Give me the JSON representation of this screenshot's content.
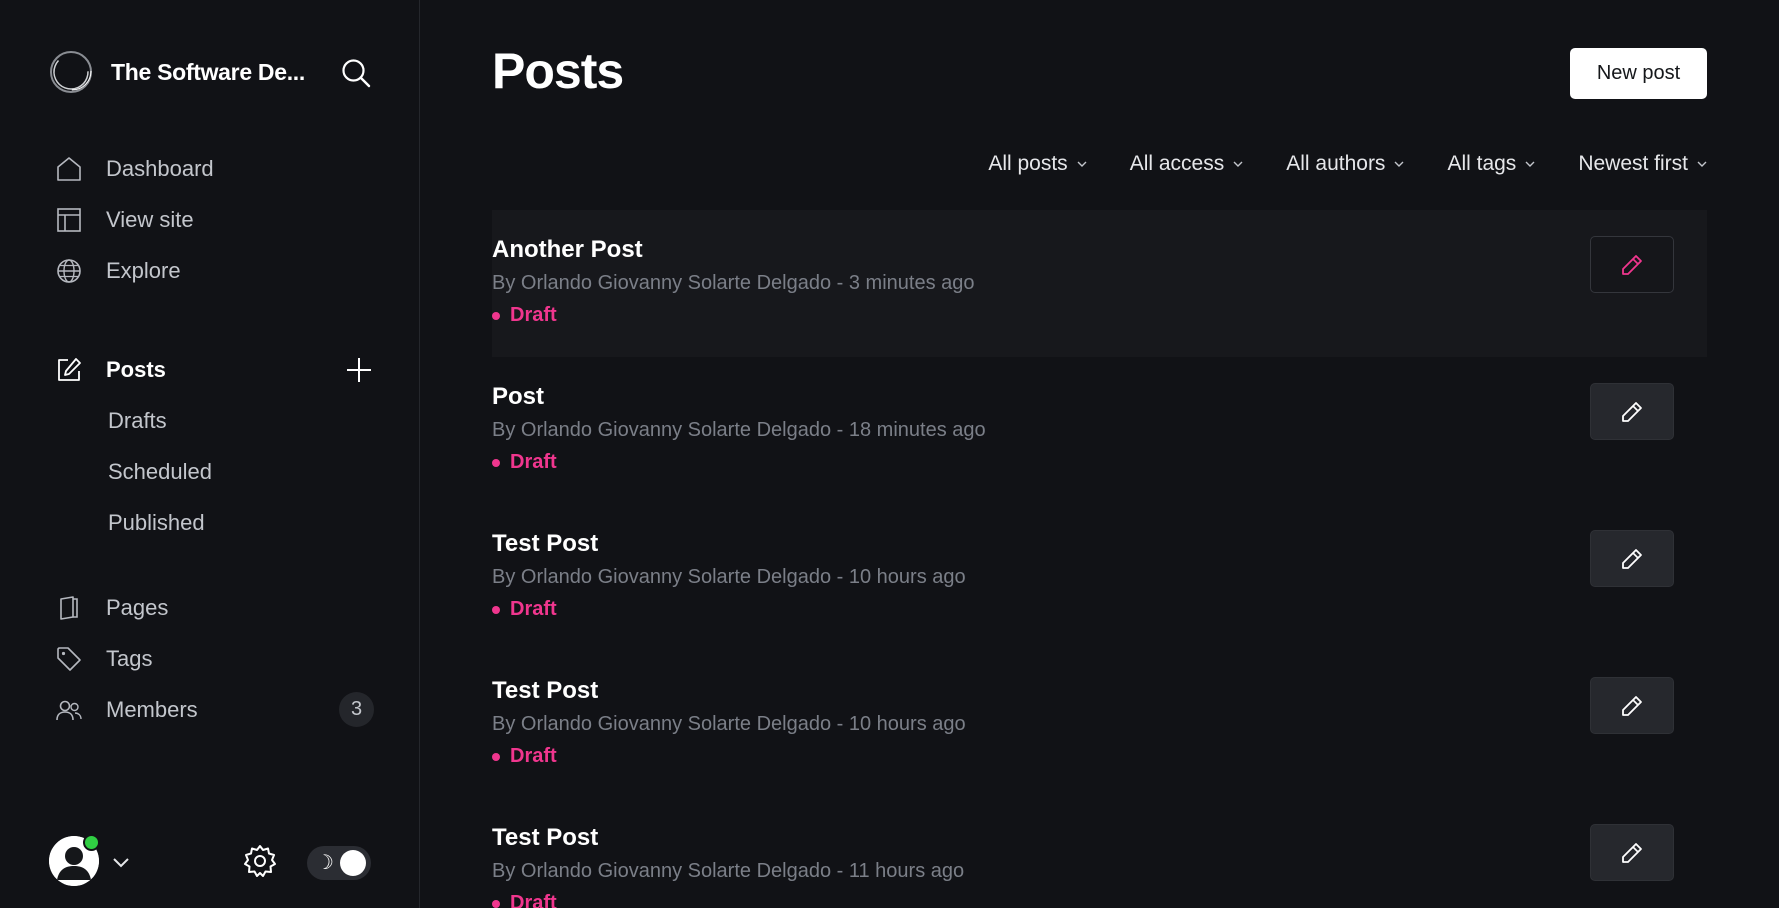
{
  "sidebar": {
    "brand_name": "The Software De...",
    "nav_top": [
      {
        "label": "Dashboard",
        "icon": "home-icon"
      },
      {
        "label": "View site",
        "icon": "layout-icon"
      },
      {
        "label": "Explore",
        "icon": "globe-icon"
      }
    ],
    "posts": {
      "label": "Posts",
      "icon": "edit-icon"
    },
    "post_subs": [
      "Drafts",
      "Scheduled",
      "Published"
    ],
    "nav_bottom": [
      {
        "label": "Pages",
        "icon": "page-icon"
      },
      {
        "label": "Tags",
        "icon": "tag-icon"
      },
      {
        "label": "Members",
        "icon": "members-icon",
        "count": "3"
      }
    ],
    "theme_moon": "☽"
  },
  "main": {
    "title": "Posts",
    "new_post_label": "New post",
    "filters": [
      "All posts",
      "All access",
      "All authors",
      "All tags",
      "Newest first"
    ],
    "posts": [
      {
        "title": "Another Post",
        "meta": "By Orlando Giovanny Solarte Delgado - 3 minutes ago",
        "status": "Draft"
      },
      {
        "title": "Post",
        "meta": "By Orlando Giovanny Solarte Delgado - 18 minutes ago",
        "status": "Draft"
      },
      {
        "title": "Test Post",
        "meta": "By Orlando Giovanny Solarte Delgado - 10 hours ago",
        "status": "Draft"
      },
      {
        "title": "Test Post",
        "meta": "By Orlando Giovanny Solarte Delgado - 10 hours ago",
        "status": "Draft"
      },
      {
        "title": "Test Post",
        "meta": "By Orlando Giovanny Solarte Delgado - 11 hours ago",
        "status": "Draft"
      }
    ]
  },
  "colors": {
    "background": "#111216",
    "accent_pink": "#f0368e",
    "online_green": "#30cf43"
  }
}
